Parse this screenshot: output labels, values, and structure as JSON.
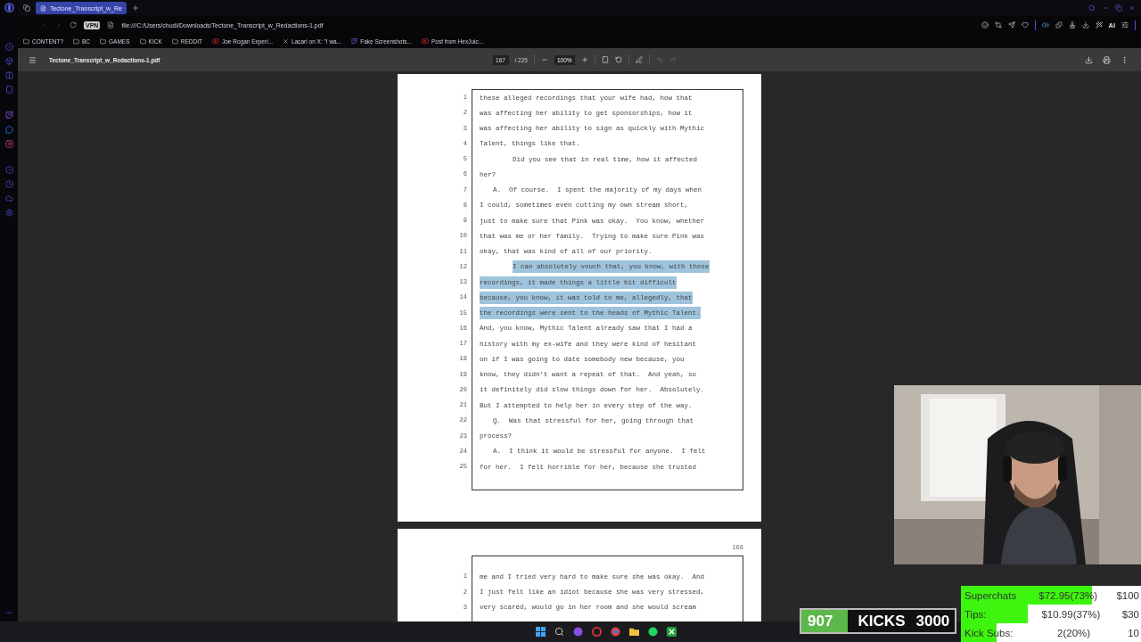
{
  "browser": {
    "tab": {
      "title": "Tectone_Transcript_w_Re",
      "selected": true
    },
    "vpn_badge": "VPN",
    "address": "file:///C:/Users/chudi/Downloads/Tectone_Transcript_w_Redactions-1.pdf",
    "bookmarks": [
      {
        "label": "CONTENT?",
        "kind": "folder"
      },
      {
        "label": "BC",
        "kind": "folder"
      },
      {
        "label": "GAMES",
        "kind": "folder"
      },
      {
        "label": "KICK",
        "kind": "folder"
      },
      {
        "label": "REDDIT",
        "kind": "folder"
      },
      {
        "label": "Joe Rogan Experi...",
        "kind": "video"
      },
      {
        "label": "Lacari on X: \"I wa...",
        "kind": "x"
      },
      {
        "label": "Fake Screenshots...",
        "kind": "stream"
      },
      {
        "label": "Post from HexJuic...",
        "kind": "video"
      }
    ],
    "ai_label": "AI"
  },
  "pdf_toolbar": {
    "title": "Tectone_Transcript_w_Redactions-1.pdf",
    "page": "167",
    "page_count": "/ 225",
    "zoom": "100%",
    "undo_disabled": true,
    "redo_disabled": true
  },
  "pages": [
    {
      "lines": [
        {
          "num": "1",
          "text": "these alleged recordings that your wife had, how that",
          "kind": "plain",
          "selected": false
        },
        {
          "num": "2",
          "text": "was affecting her ability to get sponsorships, how it",
          "kind": "plain",
          "selected": false
        },
        {
          "num": "3",
          "text": "was affecting her ability to sign as quickly with Mythic",
          "kind": "plain",
          "selected": false
        },
        {
          "num": "4",
          "text": "Talent, things like that.",
          "kind": "plain",
          "selected": false
        },
        {
          "num": "5",
          "text": "Did you see that in real time, how it affected",
          "kind": "paragraph",
          "selected": false
        },
        {
          "num": "6",
          "text": "her?",
          "kind": "plain",
          "selected": false
        },
        {
          "num": "7",
          "text": "A.  Of course.  I spent the majority of my days when",
          "kind": "answer",
          "selected": false
        },
        {
          "num": "8",
          "text": "I could, sometimes even cutting my own stream short,",
          "kind": "plain",
          "selected": false
        },
        {
          "num": "9",
          "text": "just to make sure that Pink was okay.  You know, whether",
          "kind": "plain",
          "selected": false
        },
        {
          "num": "10",
          "text": "that was me or her family.  Trying to make sure Pink was",
          "kind": "plain",
          "selected": false
        },
        {
          "num": "11",
          "text": "okay, that was kind of all of our priority.",
          "kind": "plain",
          "selected": false
        },
        {
          "num": "12",
          "text": "I can absolutely vouch that, you know, with those",
          "kind": "paragraph",
          "selected": true
        },
        {
          "num": "13",
          "text": "recordings, it made things a little bit difficult",
          "kind": "plain",
          "selected": true
        },
        {
          "num": "14",
          "text": "because, you know, it was told to me, allegedly, that",
          "kind": "plain",
          "selected": true
        },
        {
          "num": "15",
          "text": "the recordings were sent to the heads of Mythic Talent.",
          "kind": "plain",
          "selected": true
        },
        {
          "num": "16",
          "text": "And, you know, Mythic Talent already saw that I had a",
          "kind": "plain",
          "selected": false
        },
        {
          "num": "17",
          "text": "history with my ex-wife and they were kind of hesitant",
          "kind": "plain",
          "selected": false
        },
        {
          "num": "18",
          "text": "on if I was going to date somebody new because, you",
          "kind": "plain",
          "selected": false
        },
        {
          "num": "19",
          "text": "know, they didn't want a repeat of that.  And yeah, so",
          "kind": "plain",
          "selected": false
        },
        {
          "num": "20",
          "text": "it definitely did slow things down for her.  Absolutely.",
          "kind": "plain",
          "selected": false
        },
        {
          "num": "21",
          "text": "But I attempted to help her in every step of the way.",
          "kind": "plain",
          "selected": false
        },
        {
          "num": "22",
          "text": "Q.  Was that stressful for her, going through that",
          "kind": "answer",
          "selected": false
        },
        {
          "num": "23",
          "text": "process?",
          "kind": "plain",
          "selected": false
        },
        {
          "num": "24",
          "text": "A.  I think it would be stressful for anyone.  I felt",
          "kind": "answer",
          "selected": false
        },
        {
          "num": "25",
          "text": "for her.  I felt horrible for her, because she trusted",
          "kind": "plain",
          "selected": false
        }
      ]
    },
    {
      "page_number": "168",
      "lines": [
        {
          "num": "1",
          "text": "me and I tried very hard to make sure she was okay.  And",
          "kind": "plain",
          "selected": false
        },
        {
          "num": "2",
          "text": "I just felt like an idiot because she was very stressed,",
          "kind": "plain",
          "selected": false
        },
        {
          "num": "3",
          "text": "very scared, would go in her room and she would scream",
          "kind": "plain",
          "selected": false
        }
      ]
    }
  ],
  "stream_overlay": {
    "kicks": {
      "count": "907",
      "label": "KICKS",
      "goal": "3000",
      "level": 0.3
    },
    "goals": [
      {
        "label": "Superchats",
        "value": "$72.95(73%)",
        "target": "$100",
        "level": 0.73
      },
      {
        "label": "Tips:",
        "value": "$10.99(37%)",
        "target": "$30",
        "level": 0.37
      },
      {
        "label": "Kick Subs:",
        "value": "2(20%)",
        "target": "10",
        "level": 0.2
      }
    ]
  }
}
